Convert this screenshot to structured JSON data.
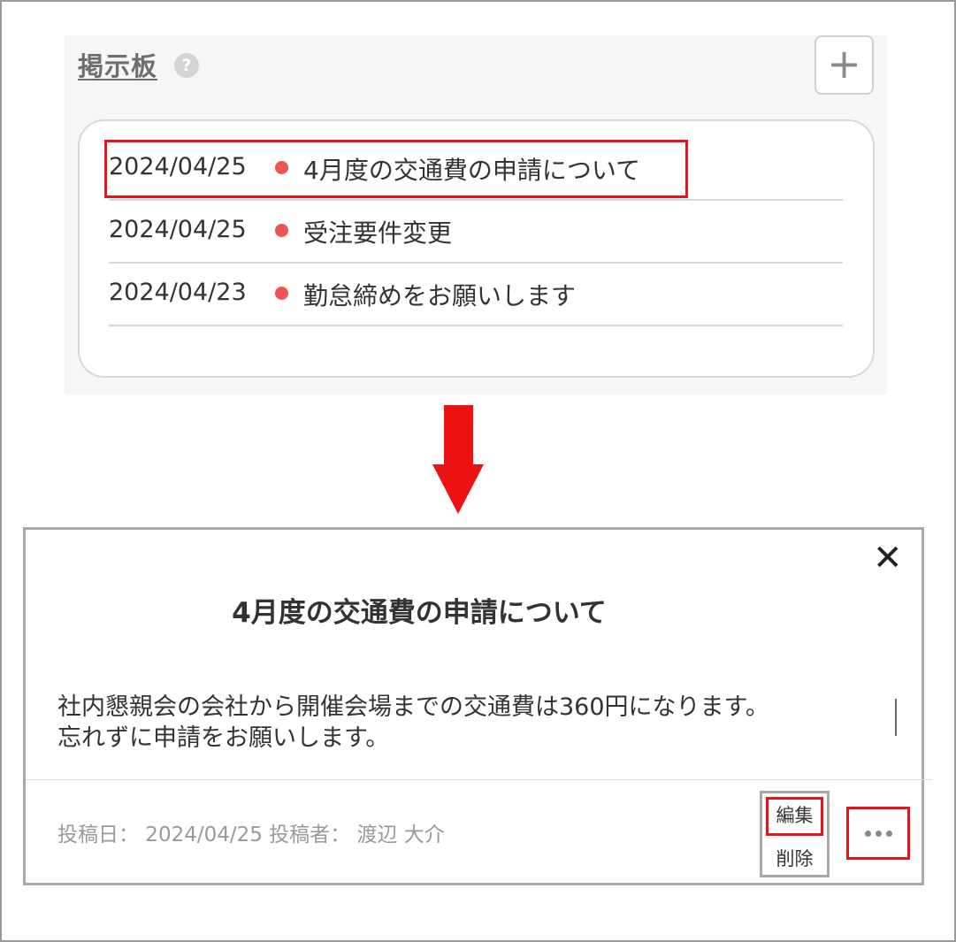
{
  "board": {
    "title": "掲示板",
    "help_glyph": "?",
    "add_glyph": "+",
    "posts": [
      {
        "date": "2024/04/25",
        "title": "4月度の交通費の申請について"
      },
      {
        "date": "2024/04/25",
        "title": "受注要件変更"
      },
      {
        "date": "2024/04/23",
        "title": "勤怠締めをお願いします"
      }
    ]
  },
  "dialog": {
    "close_glyph": "✕",
    "title": "4月度の交通費の申請について",
    "body_line1": "社内懇親会の会社から開催会場までの交通費は360円になります。",
    "body_line2": "忘れずに申請をお願いします。",
    "meta": "投稿日： 2024/04/25 投稿者： 渡辺 大介",
    "menu": {
      "edit": "編集",
      "delete": "削除"
    }
  },
  "colors": {
    "accent_red": "#e3151a",
    "unread_dot": "#ee5453",
    "arrow": "#ee1111"
  }
}
